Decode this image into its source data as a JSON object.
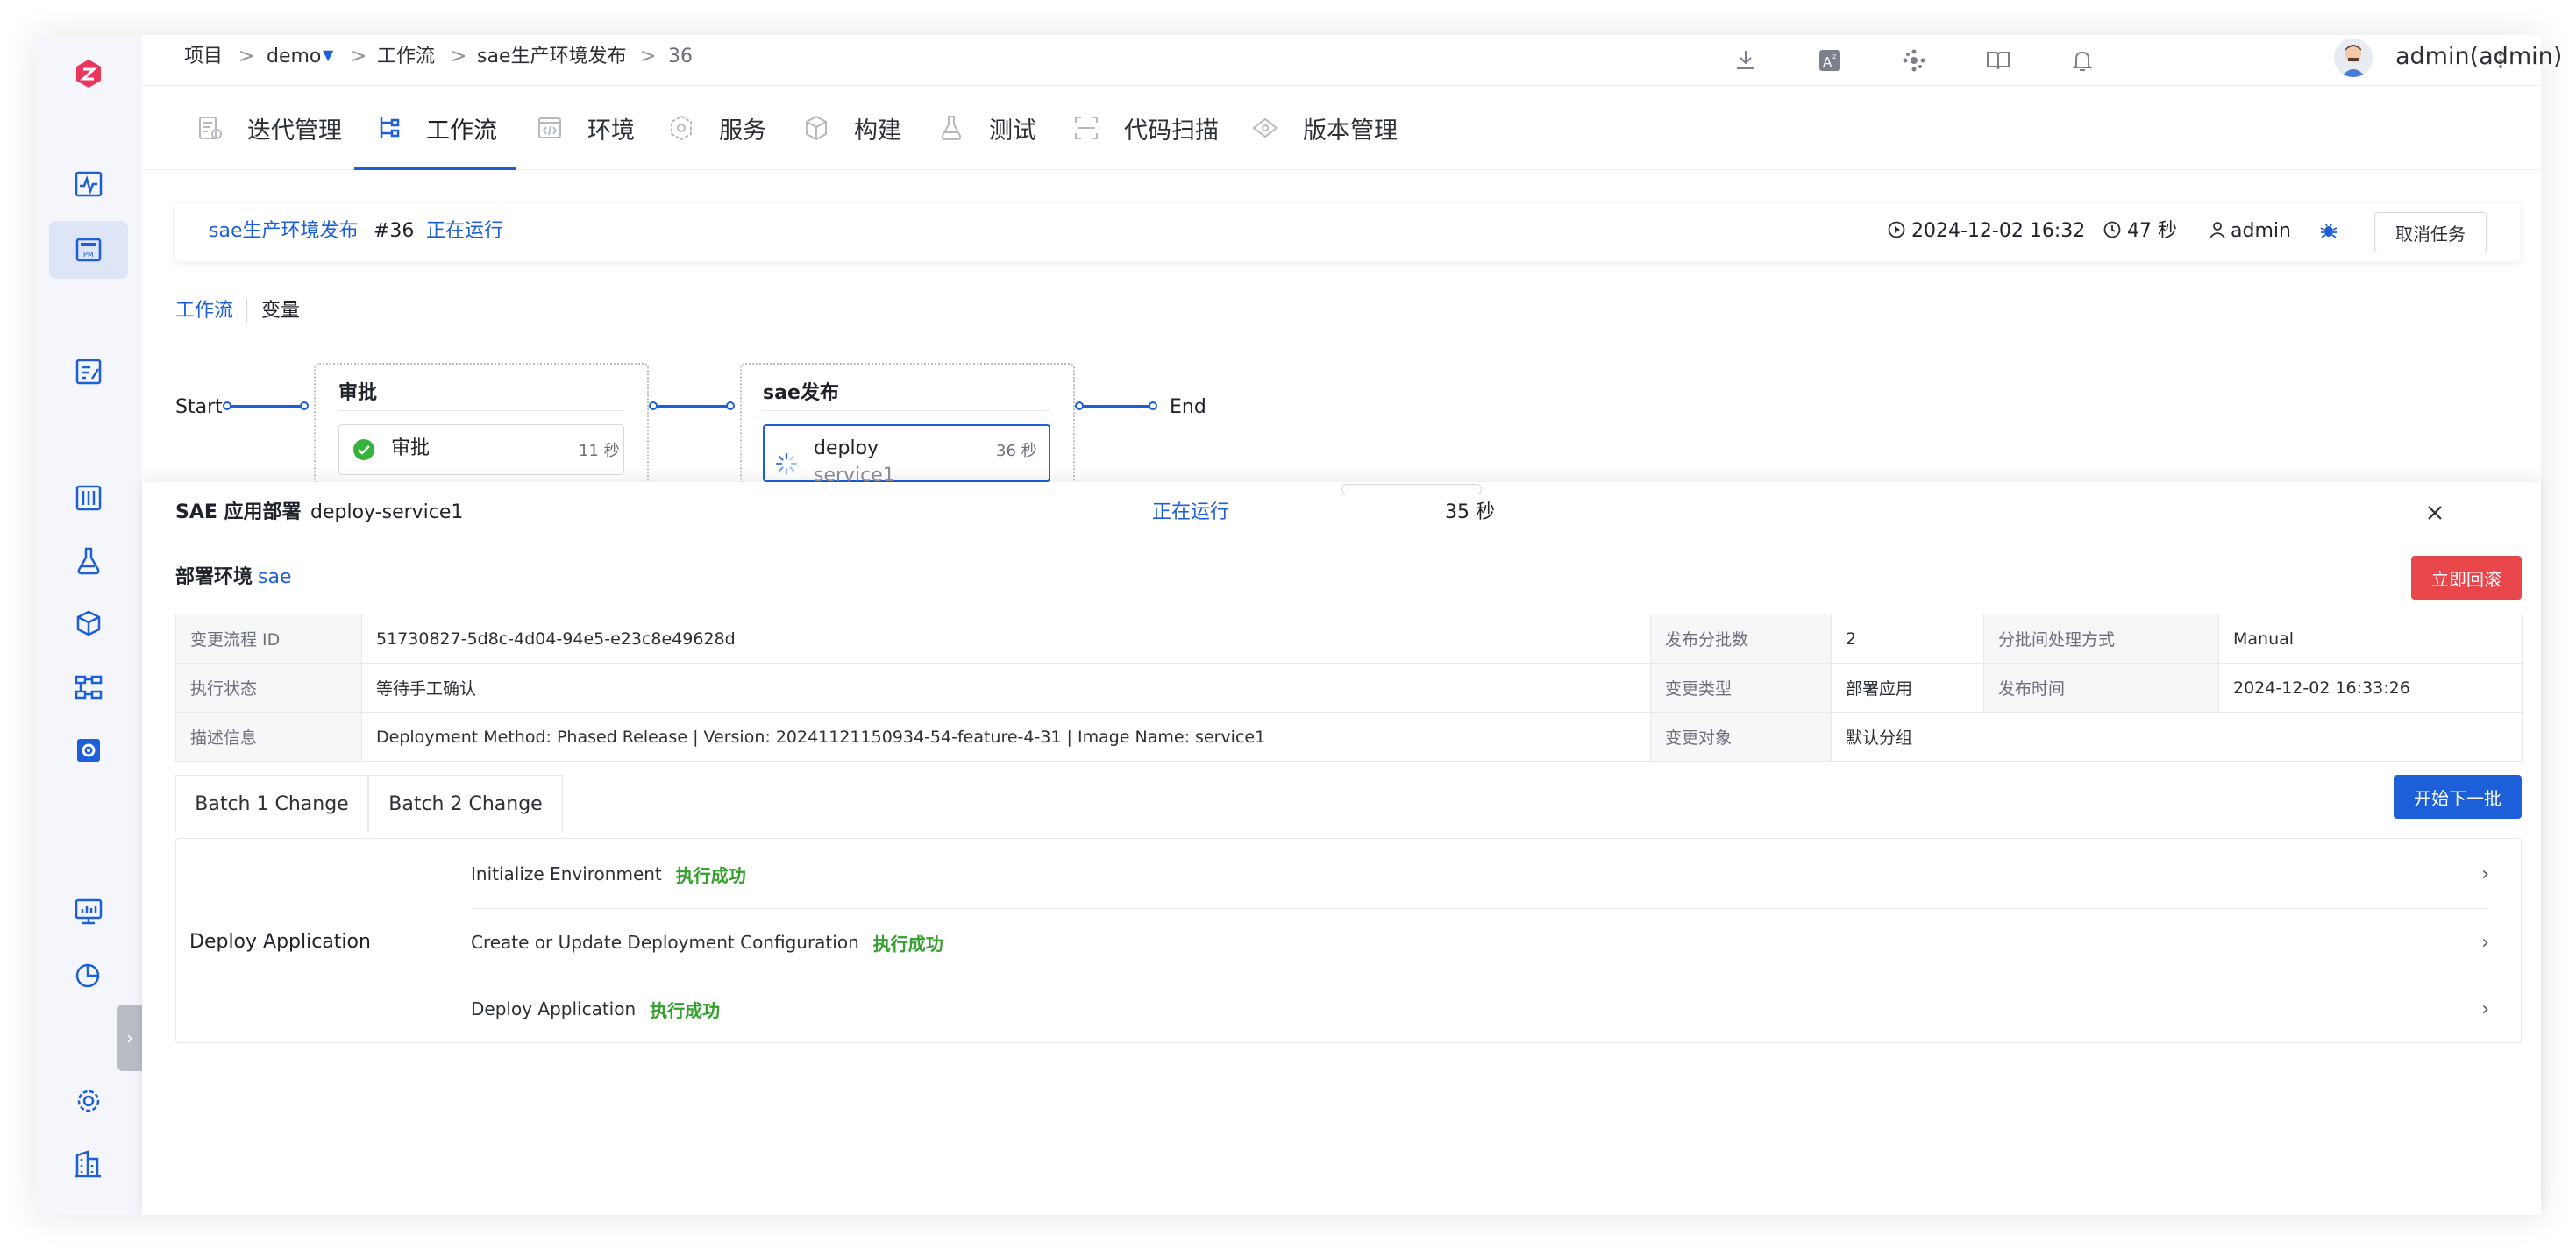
{
  "breadcrumb": {
    "project": "项目",
    "project_name": "demo",
    "workflow": "工作流",
    "workflow_name": "sae生产环境发布",
    "run_number": "36",
    "sep": ">"
  },
  "user": {
    "name": "admin(admin)"
  },
  "nav_tabs": [
    {
      "label": "迭代管理",
      "icon": "iteration-icon"
    },
    {
      "label": "工作流",
      "icon": "workflow-icon",
      "active": true
    },
    {
      "label": "环境",
      "icon": "environment-icon"
    },
    {
      "label": "服务",
      "icon": "service-icon"
    },
    {
      "label": "构建",
      "icon": "build-icon"
    },
    {
      "label": "测试",
      "icon": "test-flask-icon"
    },
    {
      "label": "代码扫描",
      "icon": "code-scan-icon"
    },
    {
      "label": "版本管理",
      "icon": "version-icon"
    }
  ],
  "task": {
    "workflow_name": "sae生产环境发布",
    "run_id": "#36",
    "status": "正在运行",
    "start_time": "2024-12-02 16:32",
    "duration": "47 秒",
    "creator": "admin",
    "cancel_label": "取消任务"
  },
  "subtabs": {
    "workflow": "工作流",
    "variables": "变量"
  },
  "pipeline": {
    "start": "Start",
    "end": "End",
    "stages": [
      {
        "title": "审批",
        "job": {
          "name": "审批",
          "duration": "11 秒",
          "status": "success"
        }
      },
      {
        "title": "sae发布",
        "job": {
          "name": "deploy",
          "sub": "service1",
          "duration": "36 秒",
          "status": "running"
        }
      }
    ]
  },
  "drawer": {
    "title": "SAE 应用部署",
    "job_name": "deploy-service1",
    "status": "正在运行",
    "duration": "35 秒",
    "env_label": "部署环境",
    "env_value": "sae",
    "rollback_label": "立即回滚",
    "next_batch_label": "开始下一批",
    "info": {
      "change_id_label": "变更流程 ID",
      "change_id": "51730827-5d8c-4d04-94e5-e23c8e49628d",
      "batch_count_label": "发布分批数",
      "batch_count": "2",
      "batch_mode_label": "分批间处理方式",
      "batch_mode": "Manual",
      "exec_status_label": "执行状态",
      "exec_status": "等待手工确认",
      "change_type_label": "变更类型",
      "change_type": "部署应用",
      "publish_time_label": "发布时间",
      "publish_time": "2024-12-02 16:33:26",
      "desc_label": "描述信息",
      "desc": "Deployment Method: Phased Release | Version: 20241121150934-54-feature-4-31 | Image Name: service1",
      "target_label": "变更对象",
      "target": "默认分组"
    },
    "batch_tabs": [
      "Batch 1 Change",
      "Batch 2 Change"
    ],
    "stage_name": "Deploy Application",
    "steps": [
      {
        "name": "Initialize Environment",
        "status": "执行成功"
      },
      {
        "name": "Create or Update Deployment Configuration",
        "status": "执行成功"
      },
      {
        "name": "Deploy Application",
        "status": "执行成功"
      }
    ]
  }
}
